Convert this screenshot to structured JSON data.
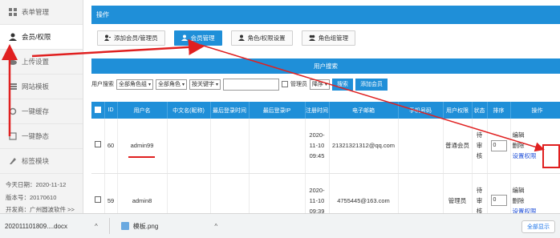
{
  "sidebar": {
    "items": [
      {
        "label": "表单管理",
        "icon": "grid-icon"
      },
      {
        "label": "会员/权限",
        "icon": "user-icon"
      },
      {
        "label": "上传设置",
        "icon": "cloud-icon"
      },
      {
        "label": "网站模板",
        "icon": "template-icon"
      },
      {
        "label": "一键缓存",
        "icon": "refresh-icon"
      },
      {
        "label": "一键静态",
        "icon": "static-icon"
      },
      {
        "label": "标签模块",
        "icon": "tag-icon"
      }
    ],
    "today": "今天日期：2020-11-12",
    "version": "版本号：20170610",
    "developer": "开发商：广州圆波软件 >>"
  },
  "operations": {
    "title": "操作",
    "buttons": [
      {
        "label": "添加会员/管理员",
        "icon": "add-user-icon"
      },
      {
        "label": "会员管理",
        "icon": "user-icon"
      },
      {
        "label": "角色/权限设置",
        "icon": "user-icon"
      },
      {
        "label": "角色组管理",
        "icon": "group-icon"
      }
    ]
  },
  "search": {
    "title": "用户搜索",
    "label": "用户搜索",
    "role_group_select": "全部角色组",
    "role_select": "全部角色",
    "keyword_select": "按关键字",
    "keyword_value": "",
    "admin_checkbox_label": "管理员",
    "order_select": "降序",
    "search_button": "搜索",
    "add_member_button": "添加会员"
  },
  "table": {
    "columns": [
      "ID",
      "用户名",
      "中文名(昵称)",
      "最后登录时间",
      "最后登录IP",
      "注册时间",
      "电子邮箱",
      "手机号码",
      "用户权限",
      "状态",
      "排序",
      "操作"
    ],
    "rows": [
      {
        "id": "60",
        "username": "admin99",
        "cname": "",
        "last_login": "",
        "last_ip": "",
        "reg_date": "2020-",
        "reg_date2": "11-10",
        "reg_time": "09:45",
        "email": "21321321312@qq.com",
        "phone": "",
        "role": "普通会员",
        "status": "待审核",
        "sort": "0",
        "op_edit": "编辑",
        "op_delete": "删除",
        "op_perm": "设置权限"
      },
      {
        "id": "59",
        "username": "admin8",
        "cname": "",
        "last_login": "",
        "last_ip": "",
        "reg_date": "2020-",
        "reg_date2": "11-10",
        "reg_time": "09:39",
        "email": "4755445@163.com",
        "phone": "",
        "role": "管理员",
        "status": "待审核",
        "sort": "0",
        "op_edit": "编辑",
        "op_delete": "删除",
        "op_perm": "设置权限"
      }
    ]
  },
  "downloads": {
    "file1": "202011101809....docx",
    "file2": "模板.png",
    "show_all": "全部显示"
  },
  "colors": {
    "accent": "#1f8fd8",
    "annotation": "#e02020"
  }
}
